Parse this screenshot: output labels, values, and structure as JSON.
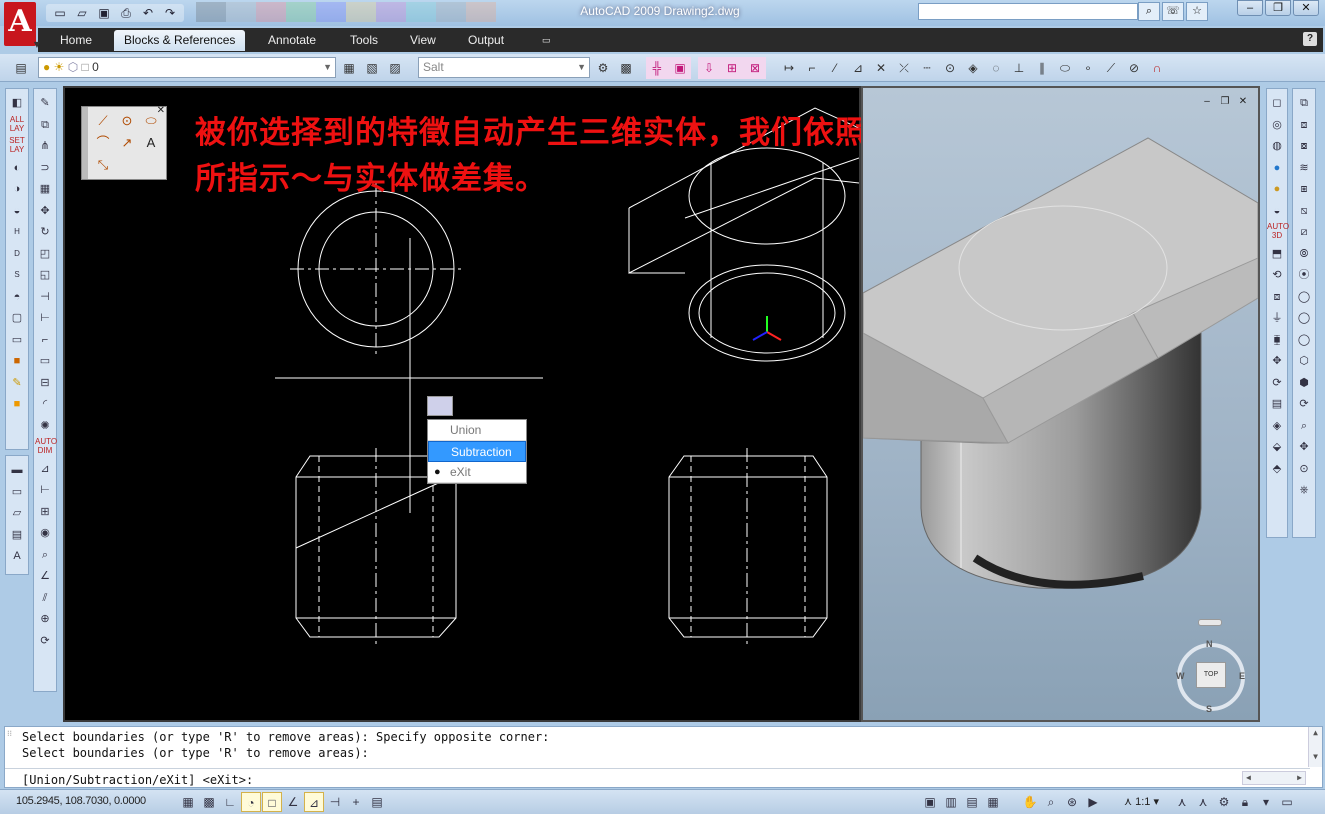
{
  "title_bar": {
    "app_title": "AutoCAD 2009 Drawing2.dwg",
    "logo_letter": "A",
    "quick_access": [
      "new-icon",
      "open-icon",
      "save-icon",
      "print-icon",
      "undo-icon",
      "redo-icon"
    ],
    "search_tools": [
      "binoculars-icon",
      "communication-icon",
      "favorites-icon"
    ],
    "window_controls": [
      "minimize-icon",
      "restore-icon",
      "close-icon"
    ]
  },
  "ribbon": {
    "tabs": [
      {
        "label": "Home",
        "active": false
      },
      {
        "label": "Blocks & References",
        "active": true
      },
      {
        "label": "Annotate",
        "active": false
      },
      {
        "label": "Tools",
        "active": false
      },
      {
        "label": "View",
        "active": false
      },
      {
        "label": "Output",
        "active": false
      }
    ],
    "help_label": "?"
  },
  "toolbars": {
    "layer_value": "0",
    "style_placeholder": "Salt"
  },
  "drawing": {
    "annotation_line1": "被你选择到的特徵自动产生三维实体，我们依照程序",
    "annotation_line2": "所指示～与实体做差集。",
    "draw_tools": [
      "line-icon",
      "circle-icon",
      "ellipse-icon",
      "arc-icon",
      "dimension-icon",
      "text-icon",
      "erase-icon"
    ]
  },
  "context_menu": {
    "items": [
      {
        "label": "Union",
        "selected": false,
        "bulleted": false
      },
      {
        "label": "Subtraction",
        "selected": true,
        "bulleted": false
      },
      {
        "label": "eXit",
        "selected": false,
        "bulleted": true
      }
    ]
  },
  "viewcube": {
    "face": "TOP",
    "north": "N",
    "south": "S",
    "east": "E",
    "west": "W"
  },
  "command": {
    "history_line1": "Select boundaries (or type 'R' to remove areas): Specify opposite corner:",
    "history_line2": "Select boundaries (or type 'R' to remove areas):",
    "prompt": "[Union/Subtraction/eXit] <eXit>:"
  },
  "status_bar": {
    "coordinates": "105.2945, 108.7030, 0.0000",
    "annotation_scale": "1:1"
  },
  "colors": {
    "annotation_text": "#ee1111",
    "menu_highlight": "#3399ff",
    "viewport_bg": "#000000"
  }
}
